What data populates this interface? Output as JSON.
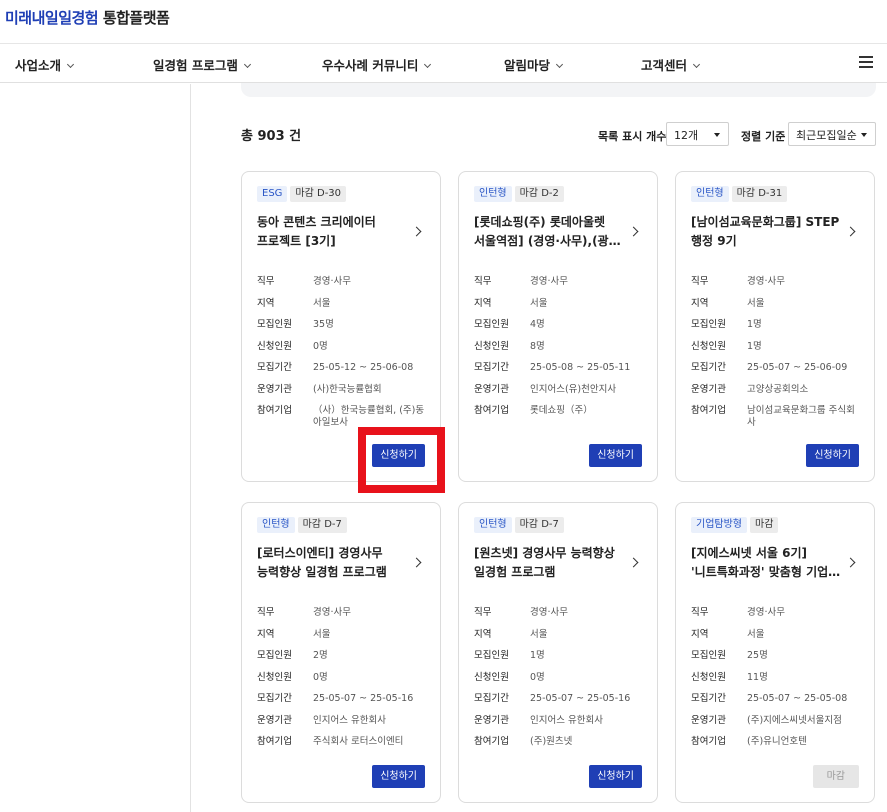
{
  "header": {
    "logo_blue": "미래내일일경험",
    "logo_dark": " 통합플랫폼"
  },
  "nav": {
    "items": [
      {
        "label": "사업소개"
      },
      {
        "label": "일경험 프로그램"
      },
      {
        "label": "우수사례 커뮤니티"
      },
      {
        "label": "알림마당"
      },
      {
        "label": "고객센터"
      }
    ]
  },
  "list": {
    "total_label": "총 903 건",
    "per_page_label": "목록 표시 개수",
    "per_page_value": "12개",
    "sort_label": "정렬 기준",
    "sort_value": "최근모집일순"
  },
  "field_labels": {
    "job": "직무",
    "region": "지역",
    "recruit": "모집인원",
    "applied": "신청인원",
    "period": "모집기간",
    "operator": "운영기관",
    "company": "참여기업"
  },
  "cards": [
    {
      "type_tag": "ESG",
      "dday_tag": "마감 D-30",
      "title_line1": "동아 콘텐츠 크리에이터",
      "title_line2": "프로젝트 [3기]",
      "job": "경영·사무",
      "region": "서울",
      "recruit": "35명",
      "applied": "0명",
      "period": "25-05-12 ~ 25-06-08",
      "operator": "(사)한국능률협회",
      "company": "（사）한국능률협회, (주)동아일보사",
      "button": "신청하기",
      "button_closed": false
    },
    {
      "type_tag": "인턴형",
      "dday_tag": "마감 D-2",
      "title_line1": "[롯데쇼핑(주) 롯데아울렛",
      "title_line2": "서울역점] (경영·사무),(광…",
      "job": "경영·사무",
      "region": "서울",
      "recruit": "4명",
      "applied": "8명",
      "period": "25-05-08 ~ 25-05-11",
      "operator": "인지어스(유)천안지사",
      "company": "롯데쇼핑（주）",
      "button": "신청하기",
      "button_closed": false
    },
    {
      "type_tag": "인턴형",
      "dday_tag": "마감 D-31",
      "title_line1": "[남이섬교육문화그룹] STEP",
      "title_line2": "행정 9기",
      "job": "경영·사무",
      "region": "서울",
      "recruit": "1명",
      "applied": "1명",
      "period": "25-05-07 ~ 25-06-09",
      "operator": "고양상공회의소",
      "company": "남이섬교육문화그룹 주식회사",
      "button": "신청하기",
      "button_closed": false
    },
    {
      "type_tag": "인턴형",
      "dday_tag": "마감 D-7",
      "title_line1": "[로터스이엔티] 경영사무",
      "title_line2": "능력향상 일경험 프로그램",
      "job": "경영·사무",
      "region": "서울",
      "recruit": "2명",
      "applied": "0명",
      "period": "25-05-07 ~ 25-05-16",
      "operator": "인지어스 유한회사",
      "company": "주식회사 로터스이엔티",
      "button": "신청하기",
      "button_closed": false
    },
    {
      "type_tag": "인턴형",
      "dday_tag": "마감 D-7",
      "title_line1": "[원츠넷] 경영사무 능력향상",
      "title_line2": "일경험 프로그램",
      "job": "경영·사무",
      "region": "서울",
      "recruit": "1명",
      "applied": "0명",
      "period": "25-05-07 ~ 25-05-16",
      "operator": "인지어스 유한회사",
      "company": "(주)원츠넷",
      "button": "신청하기",
      "button_closed": false
    },
    {
      "type_tag": "기업탐방형",
      "dday_tag": "마감",
      "title_line1": "[지에스씨넷 서울 6기]",
      "title_line2": "'니트특화과정' 맞춤형 기업탐…",
      "job": "경영·사무",
      "region": "서울",
      "recruit": "25명",
      "applied": "11명",
      "period": "25-05-07 ~ 25-05-08",
      "operator": "(주)지에스씨넷서울지점",
      "company": "(주)유니언호텐",
      "button": "마감",
      "button_closed": true
    }
  ],
  "colors": {
    "brand_blue": "#1f3fb5",
    "tag_blue_bg": "#eaf0fb",
    "highlight_red": "#e8121b"
  }
}
